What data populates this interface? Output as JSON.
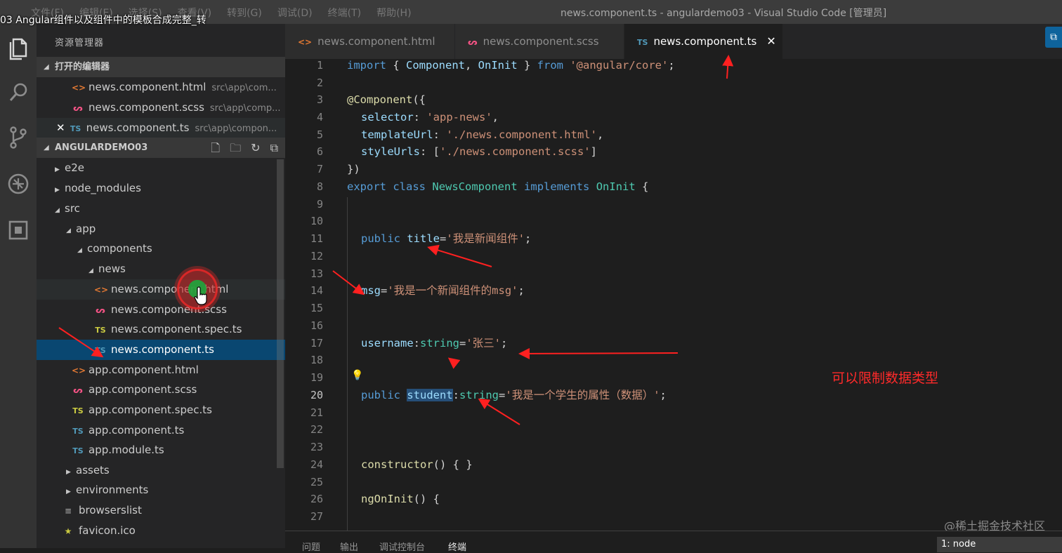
{
  "video_title": "03 Angular组件以及组件中的模板合成完整_转",
  "window": {
    "title": "news.component.ts - angulardemo03 - Visual Studio Code [管理员]",
    "menu": [
      "文件(F)",
      "编辑(E)",
      "选择(S)",
      "查看(V)",
      "转到(G)",
      "调试(D)",
      "终端(T)",
      "帮助(H)"
    ]
  },
  "activity_bar": [
    "files-icon",
    "search-icon",
    "source-control-icon",
    "debug-icon",
    "extensions-icon"
  ],
  "sidebar": {
    "title": "资源管理器",
    "open_editors": {
      "label": "打开的编辑器",
      "items": [
        {
          "name": "news.component.html",
          "path": "src\\app\\com...",
          "icon": "html"
        },
        {
          "name": "news.component.scss",
          "path": "src\\app\\comp...",
          "icon": "scss"
        },
        {
          "name": "news.component.ts",
          "path": "src\\app\\compon...",
          "icon": "ts",
          "close": "✕"
        }
      ]
    },
    "project": {
      "label": "ANGULARDEMO03",
      "tree": [
        {
          "name": "e2e",
          "type": "folder",
          "state": "collapsed"
        },
        {
          "name": "node_modules",
          "type": "folder",
          "state": "collapsed"
        },
        {
          "name": "src",
          "type": "folder",
          "state": "expanded"
        },
        {
          "name": "app",
          "type": "folder",
          "state": "expanded"
        },
        {
          "name": "components",
          "type": "folder",
          "state": "expanded"
        },
        {
          "name": "news",
          "type": "folder",
          "state": "expanded"
        },
        {
          "name": "news.component.html",
          "type": "html"
        },
        {
          "name": "news.component.scss",
          "type": "scss"
        },
        {
          "name": "news.component.spec.ts",
          "type": "spec"
        },
        {
          "name": "news.component.ts",
          "type": "ts",
          "active": true
        },
        {
          "name": "app.component.html",
          "type": "html"
        },
        {
          "name": "app.component.scss",
          "type": "scss"
        },
        {
          "name": "app.component.spec.ts",
          "type": "spec"
        },
        {
          "name": "app.component.ts",
          "type": "ts"
        },
        {
          "name": "app.module.ts",
          "type": "ts"
        },
        {
          "name": "assets",
          "type": "folder",
          "state": "collapsed"
        },
        {
          "name": "environments",
          "type": "folder",
          "state": "collapsed"
        },
        {
          "name": "browserslist",
          "type": "file"
        },
        {
          "name": "favicon.ico",
          "type": "fav"
        }
      ]
    }
  },
  "tabs": [
    {
      "label": "news.component.html",
      "icon": "html"
    },
    {
      "label": "news.component.scss",
      "icon": "scss"
    },
    {
      "label": "news.component.ts",
      "icon": "ts",
      "active": true,
      "close": "✕"
    }
  ],
  "editor": {
    "line_numbers": [
      "1",
      "2",
      "3",
      "4",
      "5",
      "6",
      "7",
      "8",
      "9",
      "10",
      "11",
      "12",
      "13",
      "14",
      "15",
      "16",
      "17",
      "18",
      "19",
      "20",
      "21",
      "22",
      "23",
      "24",
      "25",
      "26",
      "27"
    ],
    "current_line": "20",
    "lines": {
      "l1": [
        "import",
        " { ",
        "Component",
        ", ",
        "OnInit",
        " } ",
        "from",
        " ",
        "'@angular/core'",
        ";"
      ],
      "l3": [
        "@Component",
        "({"
      ],
      "l4": [
        "selector",
        ": ",
        "'app-news'",
        ","
      ],
      "l5": [
        "templateUrl",
        ": ",
        "'./news.component.html'",
        ","
      ],
      "l6": [
        "styleUrls",
        ": [",
        "'./news.component.scss'",
        "]"
      ],
      "l7": [
        "})"
      ],
      "l8": [
        "export",
        " ",
        "class",
        " ",
        "NewsComponent",
        " ",
        "implements",
        " ",
        "OnInit",
        " {"
      ],
      "l11": [
        "public",
        " ",
        "title",
        "=",
        "'我是新闻组件'",
        ";"
      ],
      "l14": [
        "msg",
        "=",
        "'我是一个新闻组件的msg'",
        ";"
      ],
      "l17": [
        "username",
        ":",
        "string",
        "=",
        "'张三'",
        ";"
      ],
      "l20": [
        "public",
        " ",
        "student",
        ":",
        "string",
        "=",
        "'我是一个学生的属性（数据）'",
        ";"
      ],
      "l24": [
        "constructor",
        "() { }"
      ],
      "l26": [
        "ngOnInit",
        "() {"
      ]
    }
  },
  "annotation": "可以限制数据类型",
  "watermark": "@稀土掘金技术社区",
  "panel": {
    "tabs": [
      "问题",
      "输出",
      "调试控制台",
      "终端"
    ],
    "active_tab": "终端",
    "terminal_select": "1: node"
  }
}
